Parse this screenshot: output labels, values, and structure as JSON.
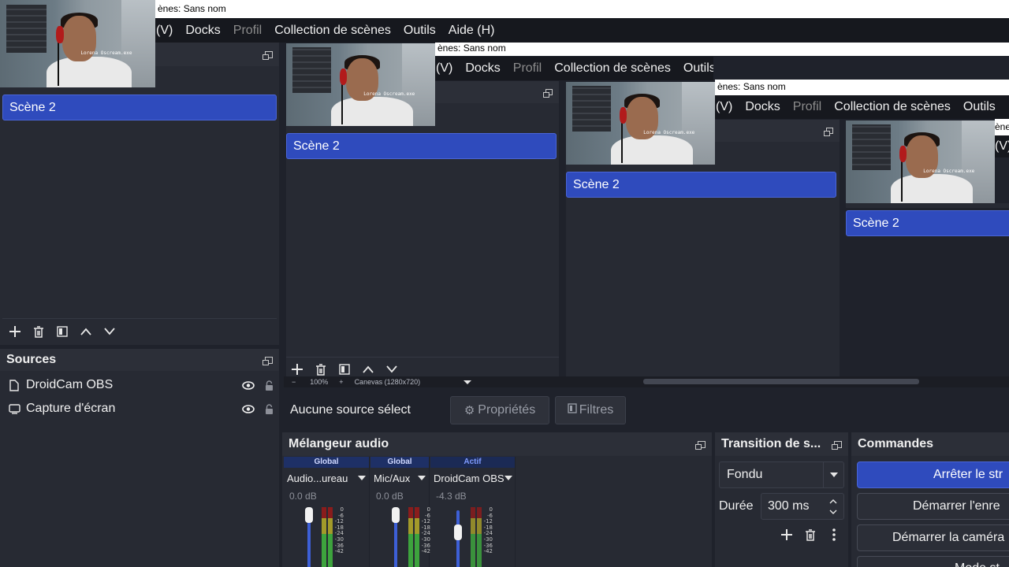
{
  "title_fragment": "ènes: Sans nom",
  "menu": {
    "view": "(V)",
    "docks": "Docks",
    "profile": "Profil",
    "scene_collection": "Collection de scènes",
    "tools": "Outils",
    "help": "Aide (H)"
  },
  "scenes": {
    "selected": "Scène 2"
  },
  "sources": {
    "title": "Sources",
    "items": [
      {
        "label": "DroidCam OBS",
        "icon": "file-icon"
      },
      {
        "label": "Capture d'écran",
        "icon": "monitor-icon"
      }
    ]
  },
  "preview": {
    "zoom": "100%",
    "canvas": "Canevas (1280x720)",
    "zoom_minus": "−",
    "zoom_plus": "+"
  },
  "context_bar": {
    "no_source": "Aucune source sélect",
    "properties": "Propriétés",
    "filters": "Filtres"
  },
  "webcam_caption": "Lorena Oscream.exe",
  "mixer": {
    "title": "Mélangeur audio",
    "channels": [
      {
        "status": "Global",
        "name": "Audio...ureau",
        "db": "0.0 dB",
        "level": 1.0
      },
      {
        "status": "Global",
        "name": "Mic/Aux",
        "db": "0.0 dB",
        "level": 1.0
      },
      {
        "status": "Actif",
        "name": "DroidCam OBS",
        "db": "-4.3 dB",
        "level": 0.8
      }
    ],
    "scale": [
      "0",
      "-6",
      "-12",
      "-18",
      "-24",
      "-30",
      "-36",
      "-42"
    ]
  },
  "transition": {
    "title": "Transition de s...",
    "type": "Fondu",
    "duration_label": "Durée",
    "duration_value": "300 ms"
  },
  "controls": {
    "title": "Commandes",
    "stop_stream": "Arrêter le str",
    "start_recording": "Démarrer l'enre",
    "start_virtualcam": "Démarrer la caméra",
    "studio_mode": "Mode st"
  },
  "colors": {
    "accent": "#2f4bbd",
    "panel": "#272a33",
    "background": "#1f222b",
    "meter_green": "#3da33d",
    "meter_yellow": "#a39a2a",
    "meter_red": "#8a1c1c"
  }
}
